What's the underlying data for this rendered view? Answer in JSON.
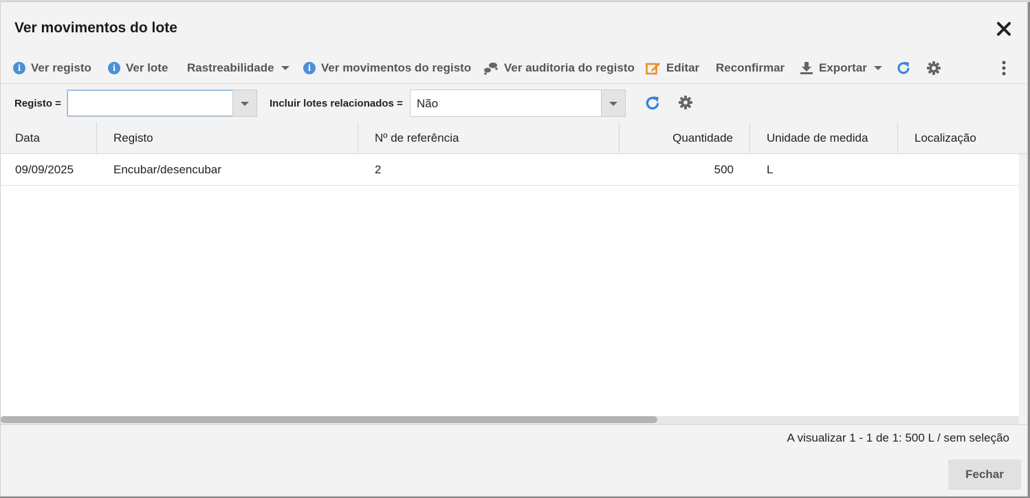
{
  "dialog": {
    "title": "Ver movimentos do lote"
  },
  "toolbar": {
    "ver_registo": "Ver registo",
    "ver_lote": "Ver lote",
    "rastreabilidade": "Rastreabilidade",
    "ver_movimentos_registo": "Ver movimentos do registo",
    "ver_auditoria_registo": "Ver auditoria do registo",
    "editar": "Editar",
    "reconfirmar": "Reconfirmar",
    "exportar": "Exportar"
  },
  "filters": {
    "registo_label": "Registo =",
    "registo_value": "",
    "incluir_label": "Incluir lotes relacionados =",
    "incluir_value": "Não"
  },
  "table": {
    "columns": [
      "Data",
      "Registo",
      "Nº de referência",
      "Quantidade",
      "Unidade de medida",
      "Localização"
    ],
    "rows": [
      {
        "data": "09/09/2025",
        "registo": "Encubar/desencubar",
        "referencia": "2",
        "quantidade": "500",
        "unidade": "L",
        "localizacao": ""
      }
    ]
  },
  "footer": {
    "status": "A visualizar 1 - 1 de 1: 500 L / sem seleção",
    "fechar": "Fechar"
  },
  "colors": {
    "accent_blue": "#4a90d9",
    "edit_orange": "#f08a24",
    "icon_gray": "#666666"
  }
}
